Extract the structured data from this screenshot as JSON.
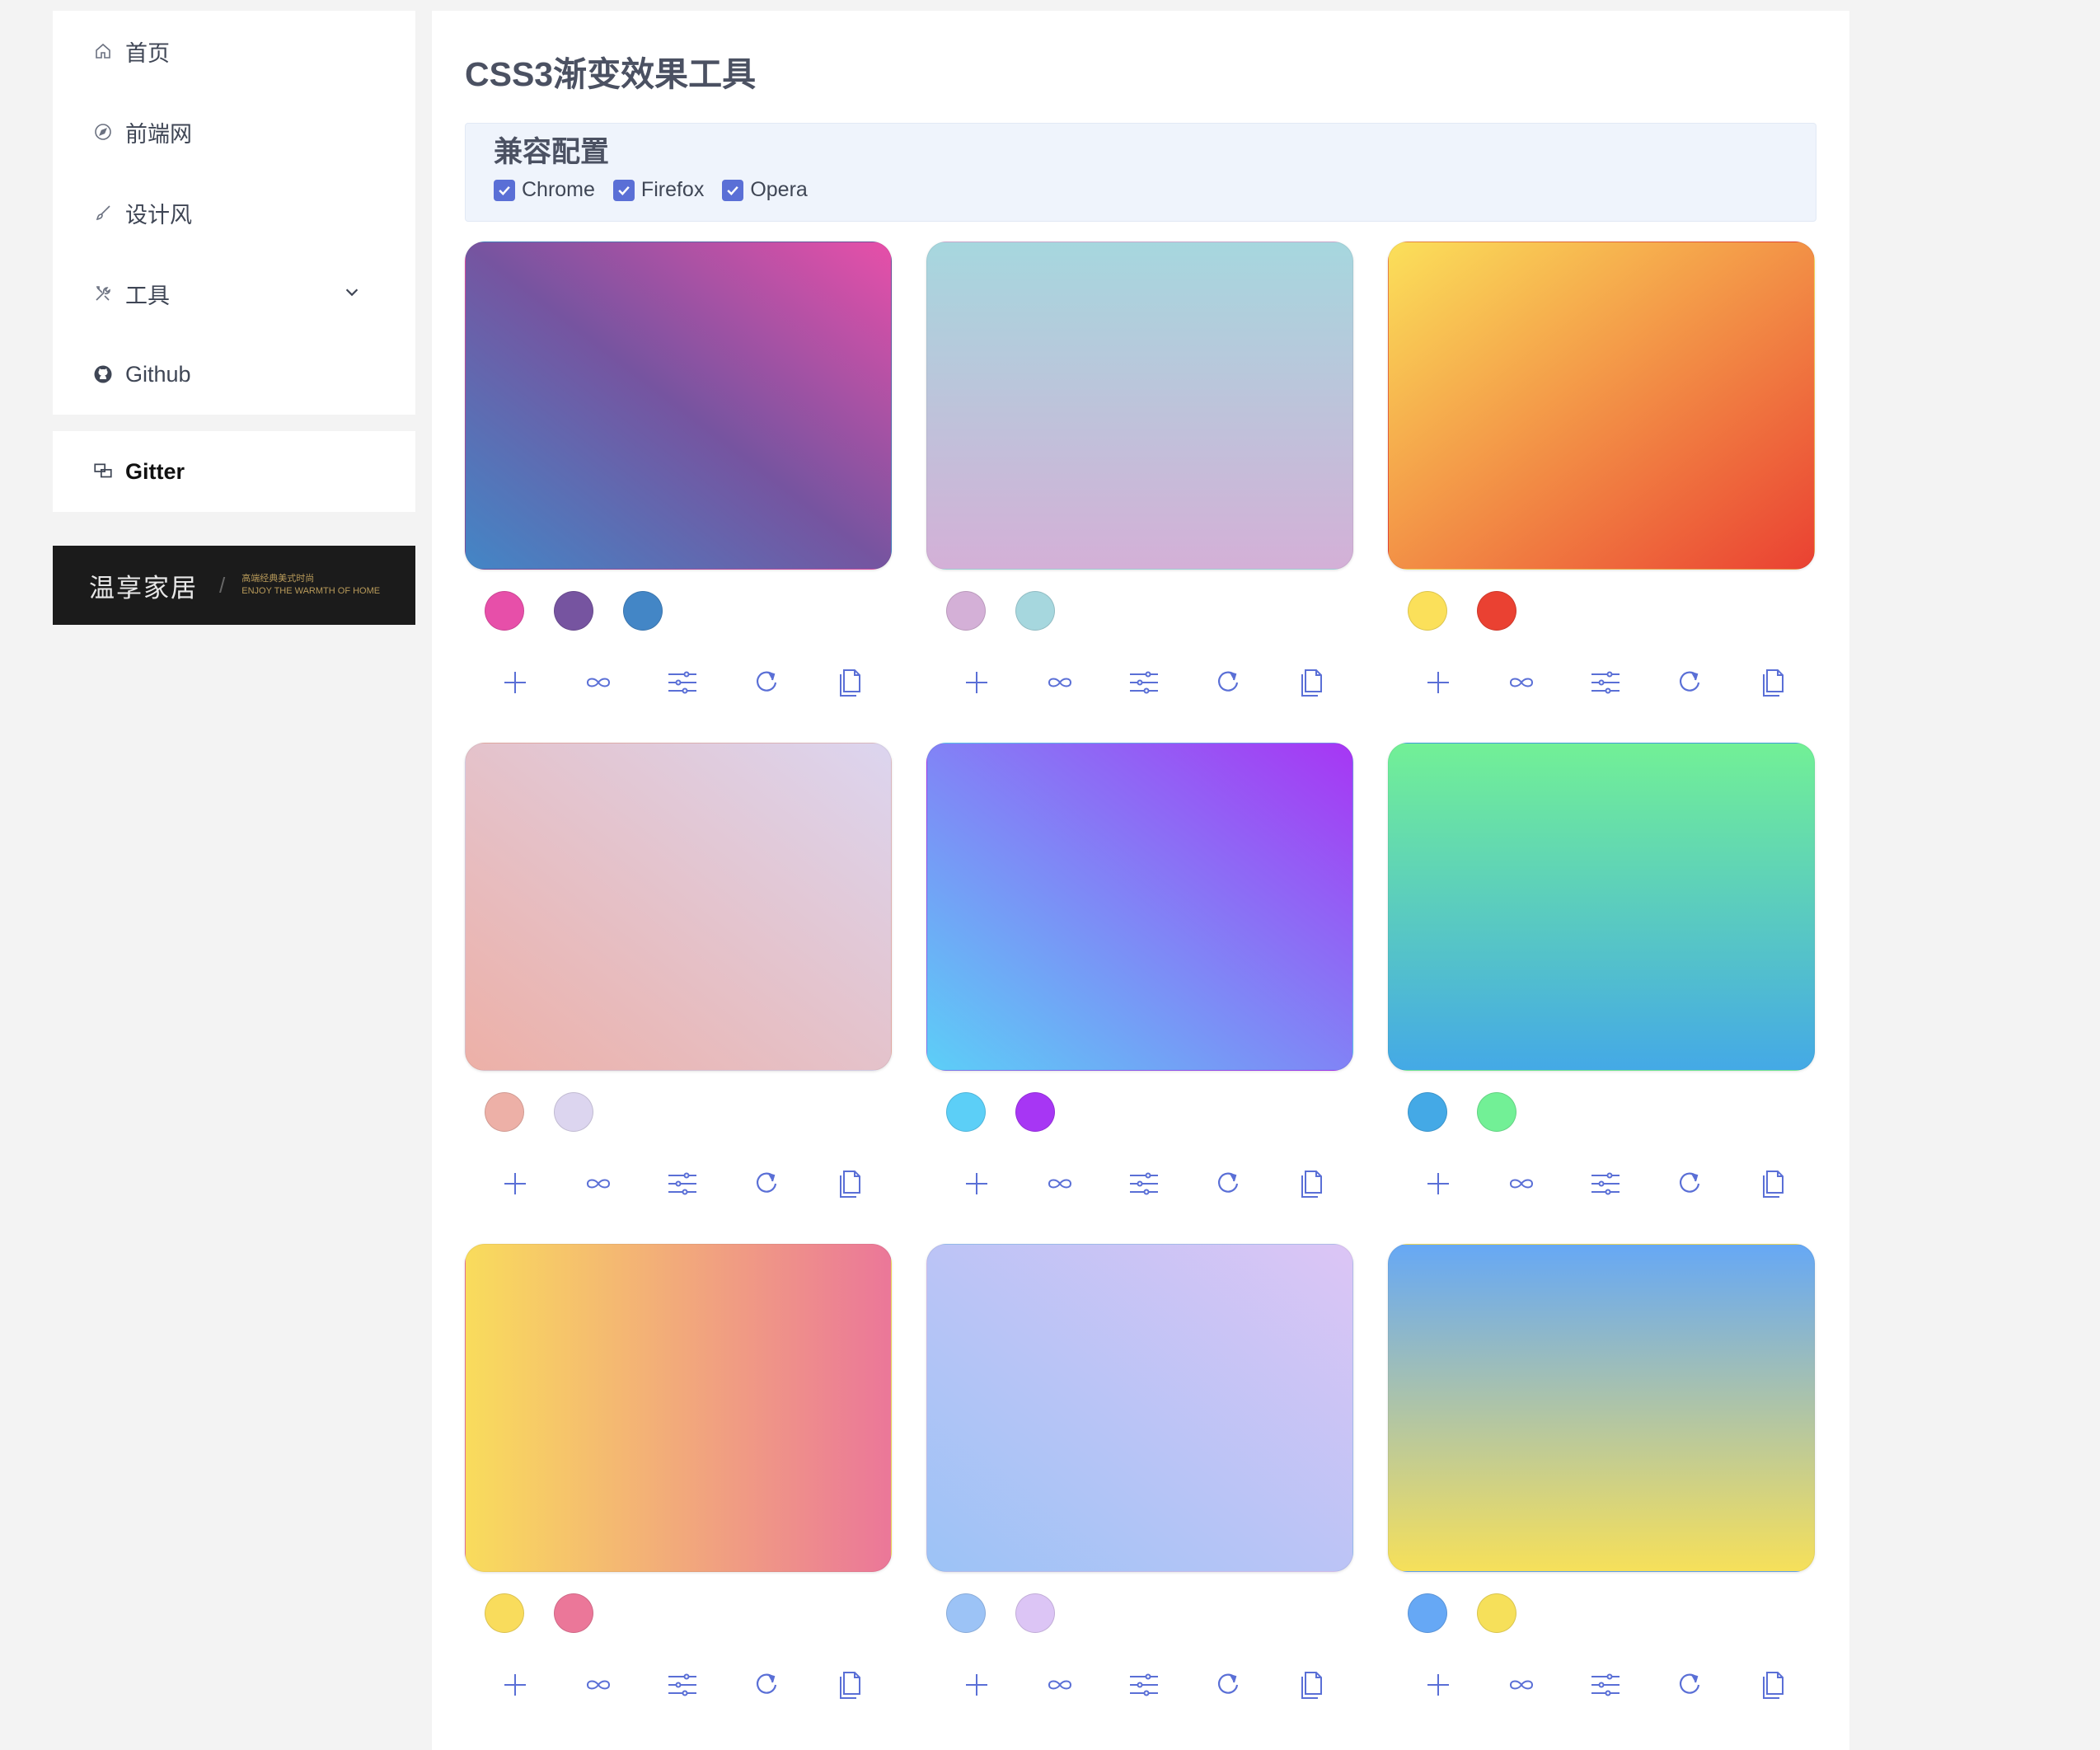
{
  "sidebar": {
    "items": [
      {
        "label": "首页",
        "icon": "home-icon"
      },
      {
        "label": "前端网",
        "icon": "compass-icon"
      },
      {
        "label": "设计风",
        "icon": "brush-icon"
      },
      {
        "label": "工具",
        "icon": "tools-icon",
        "expandable": true
      },
      {
        "label": "Github",
        "icon": "github-icon"
      }
    ],
    "gitter": {
      "label": "Gitter",
      "icon": "chat-icon"
    },
    "ad": {
      "brand": "温享家居",
      "separator": "/",
      "tagline_cn": "高端经典美式时尚",
      "tagline_en": "ENJOY THE WARMTH OF HOME"
    }
  },
  "main": {
    "title": "CSS3渐变效果工具",
    "compat": {
      "heading": "兼容配置",
      "options": [
        {
          "label": "Chrome",
          "checked": true
        },
        {
          "label": "Firefox",
          "checked": true
        },
        {
          "label": "Opera",
          "checked": true
        }
      ]
    },
    "gradients": [
      {
        "colors": [
          "#e74fa9",
          "#7654a0",
          "#4386c6"
        ],
        "angle": "to bottom left"
      },
      {
        "colors": [
          "#d4b0d7",
          "#a6d7de"
        ],
        "angle": "to top"
      },
      {
        "colors": [
          "#fbe05a",
          "#ea4132"
        ],
        "angle": "to bottom right"
      },
      {
        "colors": [
          "#edb0a7",
          "#dcd5ef"
        ],
        "angle": "to top right"
      },
      {
        "colors": [
          "#5ccff7",
          "#a736f4"
        ],
        "angle": "to top right"
      },
      {
        "colors": [
          "#44a9e6",
          "#72f096"
        ],
        "angle": "to top"
      },
      {
        "colors": [
          "#f9dc5c",
          "#eb7799"
        ],
        "angle": "to right"
      },
      {
        "colors": [
          "#9cc3f6",
          "#dcc5f5"
        ],
        "angle": "to top right"
      },
      {
        "colors": [
          "#66a8f5",
          "#f6e05a"
        ],
        "angle": "to bottom"
      }
    ],
    "tools": [
      {
        "name": "add-color-button",
        "icon": "plus-icon"
      },
      {
        "name": "loop-button",
        "icon": "infinity-icon"
      },
      {
        "name": "adjust-button",
        "icon": "sliders-icon"
      },
      {
        "name": "rotate-button",
        "icon": "rotate-icon"
      },
      {
        "name": "copy-button",
        "icon": "copy-icon"
      }
    ],
    "accent": "#5a6fd6"
  }
}
